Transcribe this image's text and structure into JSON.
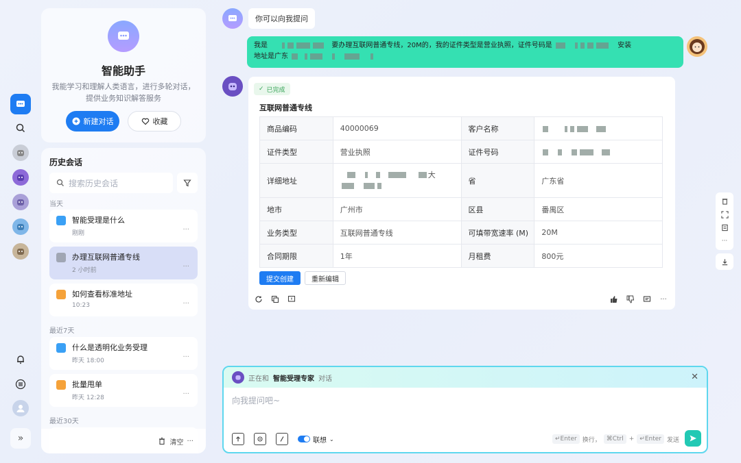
{
  "assistant": {
    "name": "智能助手",
    "description": "我能学习和理解人类语言，进行多轮对话，提供业务知识解答服务",
    "new_chat_label": "新建对话",
    "favorite_label": "收藏"
  },
  "history": {
    "title": "历史会话",
    "search_placeholder": "搜索历史会话",
    "groups": [
      {
        "label": "当天"
      },
      {
        "label": "最近7天"
      },
      {
        "label": "最近30天"
      }
    ],
    "items": [
      {
        "title": "智能受理是什么",
        "time": "刚刚",
        "color": "#3aa0f5"
      },
      {
        "title": "办理互联网普通专线",
        "time": "2 小时前",
        "color": "#a0a6b4"
      },
      {
        "title": "如何查看标准地址",
        "time": "10:23",
        "color": "#f5a23a"
      },
      {
        "title": "什么是透明化业务受理",
        "time": "昨天 18:00",
        "color": "#3aa0f5"
      },
      {
        "title": "批量甩单",
        "time": "昨天 12:28",
        "color": "#f5a23a"
      }
    ],
    "more": "···",
    "clear_label": "清空",
    "clear_more": "···"
  },
  "chat": {
    "system_prompt": "你可以向我提问",
    "user_message": {
      "part1": "我是",
      "part2": "要办理互联网普通专线，20M的，我的证件类型是营业执照，证件号码是",
      "part3": "安装",
      "part4": "地址是广东"
    },
    "result": {
      "status": "已完成",
      "title": "互联网普通专线",
      "rows": [
        {
          "l1": "商品编码",
          "v1": "40000069",
          "l2": "客户名称",
          "v2": ""
        },
        {
          "l1": "证件类型",
          "v1": "营业执照",
          "l2": "证件号码",
          "v2": ""
        },
        {
          "l1": "详细地址",
          "v1": "大",
          "l2": "省",
          "v2": "广东省"
        },
        {
          "l1": "地市",
          "v1": "广州市",
          "l2": "区县",
          "v2": "番禺区"
        },
        {
          "l1": "业务类型",
          "v1": "互联网普通专线",
          "l2": "可填带宽速率 (M)",
          "v2": "20M"
        },
        {
          "l1": "合同期限",
          "v1": "1年",
          "l2": "月租费",
          "v2": "800元"
        }
      ],
      "submit_label": "提交创建",
      "reedit_label": "重新编辑",
      "more": "···"
    }
  },
  "composer": {
    "prefix": "正在和",
    "agent": "智能受理专家",
    "suffix": "对话",
    "close": "✕",
    "placeholder": "向我提问吧~",
    "think_label": "联想",
    "hint_enter": "↵Enter",
    "hint_newline": "换行，",
    "hint_ctrl": "⌘Ctrl",
    "hint_plus": "+",
    "hint_enter2": "↵Enter",
    "hint_send": "发送"
  },
  "rail": {
    "expand": "»"
  },
  "side_tools": {
    "more": "···"
  },
  "colors": {
    "accent": "#1e7cf2",
    "user_bubble": "#35e0b2",
    "send": "#22c9b4"
  }
}
